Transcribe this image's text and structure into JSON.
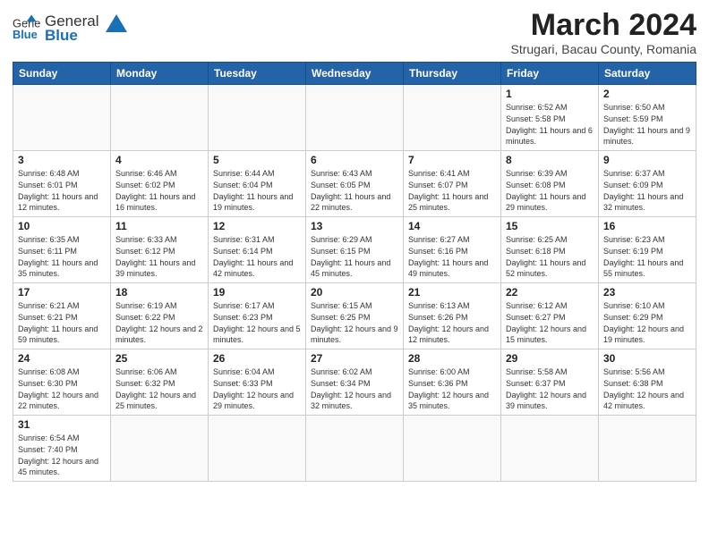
{
  "header": {
    "logo_general": "General",
    "logo_blue": "Blue",
    "month_title": "March 2024",
    "subtitle": "Strugari, Bacau County, Romania"
  },
  "weekdays": [
    "Sunday",
    "Monday",
    "Tuesday",
    "Wednesday",
    "Thursday",
    "Friday",
    "Saturday"
  ],
  "weeks": [
    [
      {
        "day": "",
        "info": ""
      },
      {
        "day": "",
        "info": ""
      },
      {
        "day": "",
        "info": ""
      },
      {
        "day": "",
        "info": ""
      },
      {
        "day": "",
        "info": ""
      },
      {
        "day": "1",
        "info": "Sunrise: 6:52 AM\nSunset: 5:58 PM\nDaylight: 11 hours and 6 minutes."
      },
      {
        "day": "2",
        "info": "Sunrise: 6:50 AM\nSunset: 5:59 PM\nDaylight: 11 hours and 9 minutes."
      }
    ],
    [
      {
        "day": "3",
        "info": "Sunrise: 6:48 AM\nSunset: 6:01 PM\nDaylight: 11 hours and 12 minutes."
      },
      {
        "day": "4",
        "info": "Sunrise: 6:46 AM\nSunset: 6:02 PM\nDaylight: 11 hours and 16 minutes."
      },
      {
        "day": "5",
        "info": "Sunrise: 6:44 AM\nSunset: 6:04 PM\nDaylight: 11 hours and 19 minutes."
      },
      {
        "day": "6",
        "info": "Sunrise: 6:43 AM\nSunset: 6:05 PM\nDaylight: 11 hours and 22 minutes."
      },
      {
        "day": "7",
        "info": "Sunrise: 6:41 AM\nSunset: 6:07 PM\nDaylight: 11 hours and 25 minutes."
      },
      {
        "day": "8",
        "info": "Sunrise: 6:39 AM\nSunset: 6:08 PM\nDaylight: 11 hours and 29 minutes."
      },
      {
        "day": "9",
        "info": "Sunrise: 6:37 AM\nSunset: 6:09 PM\nDaylight: 11 hours and 32 minutes."
      }
    ],
    [
      {
        "day": "10",
        "info": "Sunrise: 6:35 AM\nSunset: 6:11 PM\nDaylight: 11 hours and 35 minutes."
      },
      {
        "day": "11",
        "info": "Sunrise: 6:33 AM\nSunset: 6:12 PM\nDaylight: 11 hours and 39 minutes."
      },
      {
        "day": "12",
        "info": "Sunrise: 6:31 AM\nSunset: 6:14 PM\nDaylight: 11 hours and 42 minutes."
      },
      {
        "day": "13",
        "info": "Sunrise: 6:29 AM\nSunset: 6:15 PM\nDaylight: 11 hours and 45 minutes."
      },
      {
        "day": "14",
        "info": "Sunrise: 6:27 AM\nSunset: 6:16 PM\nDaylight: 11 hours and 49 minutes."
      },
      {
        "day": "15",
        "info": "Sunrise: 6:25 AM\nSunset: 6:18 PM\nDaylight: 11 hours and 52 minutes."
      },
      {
        "day": "16",
        "info": "Sunrise: 6:23 AM\nSunset: 6:19 PM\nDaylight: 11 hours and 55 minutes."
      }
    ],
    [
      {
        "day": "17",
        "info": "Sunrise: 6:21 AM\nSunset: 6:21 PM\nDaylight: 11 hours and 59 minutes."
      },
      {
        "day": "18",
        "info": "Sunrise: 6:19 AM\nSunset: 6:22 PM\nDaylight: 12 hours and 2 minutes."
      },
      {
        "day": "19",
        "info": "Sunrise: 6:17 AM\nSunset: 6:23 PM\nDaylight: 12 hours and 5 minutes."
      },
      {
        "day": "20",
        "info": "Sunrise: 6:15 AM\nSunset: 6:25 PM\nDaylight: 12 hours and 9 minutes."
      },
      {
        "day": "21",
        "info": "Sunrise: 6:13 AM\nSunset: 6:26 PM\nDaylight: 12 hours and 12 minutes."
      },
      {
        "day": "22",
        "info": "Sunrise: 6:12 AM\nSunset: 6:27 PM\nDaylight: 12 hours and 15 minutes."
      },
      {
        "day": "23",
        "info": "Sunrise: 6:10 AM\nSunset: 6:29 PM\nDaylight: 12 hours and 19 minutes."
      }
    ],
    [
      {
        "day": "24",
        "info": "Sunrise: 6:08 AM\nSunset: 6:30 PM\nDaylight: 12 hours and 22 minutes."
      },
      {
        "day": "25",
        "info": "Sunrise: 6:06 AM\nSunset: 6:32 PM\nDaylight: 12 hours and 25 minutes."
      },
      {
        "day": "26",
        "info": "Sunrise: 6:04 AM\nSunset: 6:33 PM\nDaylight: 12 hours and 29 minutes."
      },
      {
        "day": "27",
        "info": "Sunrise: 6:02 AM\nSunset: 6:34 PM\nDaylight: 12 hours and 32 minutes."
      },
      {
        "day": "28",
        "info": "Sunrise: 6:00 AM\nSunset: 6:36 PM\nDaylight: 12 hours and 35 minutes."
      },
      {
        "day": "29",
        "info": "Sunrise: 5:58 AM\nSunset: 6:37 PM\nDaylight: 12 hours and 39 minutes."
      },
      {
        "day": "30",
        "info": "Sunrise: 5:56 AM\nSunset: 6:38 PM\nDaylight: 12 hours and 42 minutes."
      }
    ],
    [
      {
        "day": "31",
        "info": "Sunrise: 6:54 AM\nSunset: 7:40 PM\nDaylight: 12 hours and 45 minutes."
      },
      {
        "day": "",
        "info": ""
      },
      {
        "day": "",
        "info": ""
      },
      {
        "day": "",
        "info": ""
      },
      {
        "day": "",
        "info": ""
      },
      {
        "day": "",
        "info": ""
      },
      {
        "day": "",
        "info": ""
      }
    ]
  ]
}
